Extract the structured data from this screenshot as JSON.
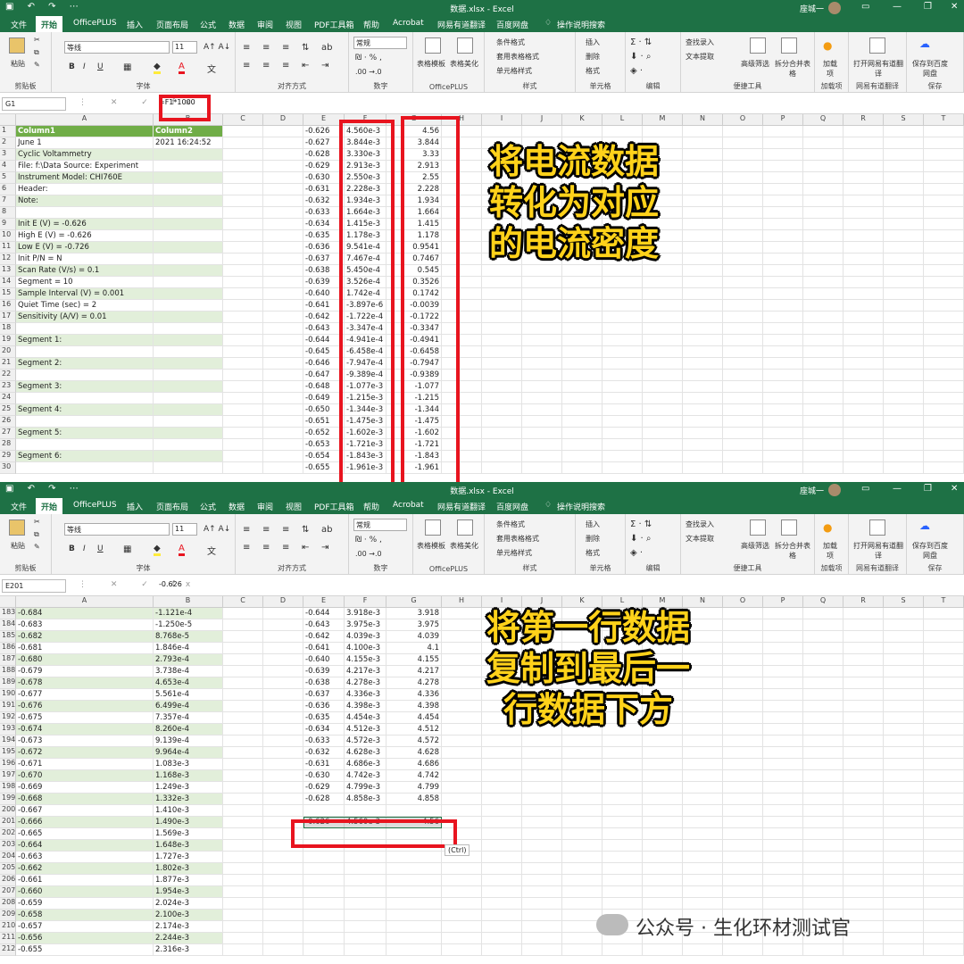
{
  "excel": {
    "title": "数据.xlsx  -  Excel",
    "user": "座城一",
    "tabs": [
      "文件",
      "开始",
      "OfficePLUS",
      "插入",
      "页面布局",
      "公式",
      "数据",
      "审阅",
      "视图",
      "PDF工具箱",
      "帮助",
      "Acrobat",
      "网易有道翻译",
      "百度网盘"
    ],
    "search": "操作说明搜索",
    "ribbon": {
      "paste": "粘贴",
      "font_name": "等线",
      "font_size": "11",
      "number_format": "常规",
      "groups": [
        "剪贴板",
        "字体",
        "对齐方式",
        "数字",
        "OfficePLUS",
        "样式",
        "单元格",
        "编辑",
        "便捷工具",
        "加载项",
        "网易有道翻译",
        "保存"
      ],
      "table_template": "表格模板",
      "table_beautify": "表格美化",
      "cond_format": "条件格式",
      "table_style": "套用表格格式",
      "cell_style": "单元格样式",
      "insert": "插入",
      "delete": "删除",
      "format": "格式",
      "find_input": "查找录入",
      "text_extract": "文本提取",
      "adv_filter": "高级筛选",
      "split_merge": "拆分合并表格",
      "addin": "加载项",
      "open_youdao": "打开网易有道翻译",
      "save_baidu": "保存到百度网盘"
    },
    "colors": {
      "excel_green": "#1e7145",
      "band": "#e2efda",
      "header": "#70ad47",
      "highlight": "#e8141f",
      "caption": "#ffd21a"
    }
  },
  "panel1": {
    "namebox": "G1",
    "formula": "=F1*1000",
    "columns": [
      "A",
      "B",
      "C",
      "D",
      "E",
      "F",
      "G",
      "H",
      "I",
      "J",
      "K",
      "L",
      "M",
      "N",
      "O",
      "P",
      "Q",
      "R",
      "S",
      "T"
    ],
    "header_a": "Column1",
    "header_b": "Column2",
    "rows": [
      {
        "n": "1",
        "a": "Column1",
        "b": "Column2",
        "e": "-0.626",
        "f": "4.560e-3",
        "g": "4.56"
      },
      {
        "n": "2",
        "a": "June 1",
        "b": "2021   16:24:52",
        "e": "-0.627",
        "f": "3.844e-3",
        "g": "3.844"
      },
      {
        "n": "3",
        "a": "Cyclic Voltammetry",
        "b": "",
        "e": "-0.628",
        "f": "3.330e-3",
        "g": "3.33"
      },
      {
        "n": "4",
        "a": "File: f:\\Data Source:  Experiment",
        "b": "",
        "e": "-0.629",
        "f": "2.913e-3",
        "g": "2.913"
      },
      {
        "n": "5",
        "a": "Instrument Model:  CHI760E",
        "b": "",
        "e": "-0.630",
        "f": "2.550e-3",
        "g": "2.55"
      },
      {
        "n": "6",
        "a": "Header:",
        "b": "",
        "e": "-0.631",
        "f": "2.228e-3",
        "g": "2.228"
      },
      {
        "n": "7",
        "a": "Note:",
        "b": "",
        "e": "-0.632",
        "f": "1.934e-3",
        "g": "1.934"
      },
      {
        "n": "8",
        "a": "",
        "b": "",
        "e": "-0.633",
        "f": "1.664e-3",
        "g": "1.664"
      },
      {
        "n": "9",
        "a": "Init E (V) = -0.626",
        "b": "",
        "e": "-0.634",
        "f": "1.415e-3",
        "g": "1.415"
      },
      {
        "n": "10",
        "a": "High E (V) = -0.626",
        "b": "",
        "e": "-0.635",
        "f": "1.178e-3",
        "g": "1.178"
      },
      {
        "n": "11",
        "a": "Low E (V) = -0.726",
        "b": "",
        "e": "-0.636",
        "f": "9.541e-4",
        "g": "0.9541"
      },
      {
        "n": "12",
        "a": "Init P/N = N",
        "b": "",
        "e": "-0.637",
        "f": "7.467e-4",
        "g": "0.7467"
      },
      {
        "n": "13",
        "a": "Scan Rate (V/s) = 0.1",
        "b": "",
        "e": "-0.638",
        "f": "5.450e-4",
        "g": "0.545"
      },
      {
        "n": "14",
        "a": "Segment = 10",
        "b": "",
        "e": "-0.639",
        "f": "3.526e-4",
        "g": "0.3526"
      },
      {
        "n": "15",
        "a": "Sample Interval (V) = 0.001",
        "b": "",
        "e": "-0.640",
        "f": "1.742e-4",
        "g": "0.1742"
      },
      {
        "n": "16",
        "a": "Quiet Time (sec) = 2",
        "b": "",
        "e": "-0.641",
        "f": "-3.897e-6",
        "g": "-0.0039"
      },
      {
        "n": "17",
        "a": "Sensitivity (A/V) = 0.01",
        "b": "",
        "e": "-0.642",
        "f": "-1.722e-4",
        "g": "-0.1722"
      },
      {
        "n": "18",
        "a": "",
        "b": "",
        "e": "-0.643",
        "f": "-3.347e-4",
        "g": "-0.3347"
      },
      {
        "n": "19",
        "a": "Segment 1:",
        "b": "",
        "e": "-0.644",
        "f": "-4.941e-4",
        "g": "-0.4941"
      },
      {
        "n": "20",
        "a": "",
        "b": "",
        "e": "-0.645",
        "f": "-6.458e-4",
        "g": "-0.6458"
      },
      {
        "n": "21",
        "a": "Segment 2:",
        "b": "",
        "e": "-0.646",
        "f": "-7.947e-4",
        "g": "-0.7947"
      },
      {
        "n": "22",
        "a": "",
        "b": "",
        "e": "-0.647",
        "f": "-9.389e-4",
        "g": "-0.9389"
      },
      {
        "n": "23",
        "a": "Segment 3:",
        "b": "",
        "e": "-0.648",
        "f": "-1.077e-3",
        "g": "-1.077"
      },
      {
        "n": "24",
        "a": "",
        "b": "",
        "e": "-0.649",
        "f": "-1.215e-3",
        "g": "-1.215"
      },
      {
        "n": "25",
        "a": "Segment 4:",
        "b": "",
        "e": "-0.650",
        "f": "-1.344e-3",
        "g": "-1.344"
      },
      {
        "n": "26",
        "a": "",
        "b": "",
        "e": "-0.651",
        "f": "-1.475e-3",
        "g": "-1.475"
      },
      {
        "n": "27",
        "a": "Segment 5:",
        "b": "",
        "e": "-0.652",
        "f": "-1.602e-3",
        "g": "-1.602"
      },
      {
        "n": "28",
        "a": "",
        "b": "",
        "e": "-0.653",
        "f": "-1.721e-3",
        "g": "-1.721"
      },
      {
        "n": "29",
        "a": "Segment 6:",
        "b": "",
        "e": "-0.654",
        "f": "-1.843e-3",
        "g": "-1.843"
      },
      {
        "n": "30",
        "a": "",
        "b": "",
        "e": "-0.655",
        "f": "-1.961e-3",
        "g": "-1.961"
      }
    ],
    "caption": [
      "将电流数据",
      "转化为对应",
      "的电流密度"
    ]
  },
  "panel2": {
    "namebox": "E201",
    "formula": "-0.626",
    "columns": [
      "A",
      "B",
      "C",
      "D",
      "E",
      "F",
      "G",
      "H",
      "I",
      "J",
      "K",
      "L",
      "M",
      "N",
      "O",
      "P",
      "Q",
      "R",
      "S",
      "T"
    ],
    "rows": [
      {
        "n": "183",
        "a": "-0.684",
        "b": "-1.121e-4",
        "e": "-0.644",
        "f": "3.918e-3",
        "g": "3.918"
      },
      {
        "n": "184",
        "a": "-0.683",
        "b": "-1.250e-5",
        "e": "-0.643",
        "f": "3.975e-3",
        "g": "3.975"
      },
      {
        "n": "185",
        "a": "-0.682",
        "b": "8.768e-5",
        "e": "-0.642",
        "f": "4.039e-3",
        "g": "4.039"
      },
      {
        "n": "186",
        "a": "-0.681",
        "b": "1.846e-4",
        "e": "-0.641",
        "f": "4.100e-3",
        "g": "4.1"
      },
      {
        "n": "187",
        "a": "-0.680",
        "b": "2.793e-4",
        "e": "-0.640",
        "f": "4.155e-3",
        "g": "4.155"
      },
      {
        "n": "188",
        "a": "-0.679",
        "b": "3.738e-4",
        "e": "-0.639",
        "f": "4.217e-3",
        "g": "4.217"
      },
      {
        "n": "189",
        "a": "-0.678",
        "b": "4.653e-4",
        "e": "-0.638",
        "f": "4.278e-3",
        "g": "4.278"
      },
      {
        "n": "190",
        "a": "-0.677",
        "b": "5.561e-4",
        "e": "-0.637",
        "f": "4.336e-3",
        "g": "4.336"
      },
      {
        "n": "191",
        "a": "-0.676",
        "b": "6.499e-4",
        "e": "-0.636",
        "f": "4.398e-3",
        "g": "4.398"
      },
      {
        "n": "192",
        "a": "-0.675",
        "b": "7.357e-4",
        "e": "-0.635",
        "f": "4.454e-3",
        "g": "4.454"
      },
      {
        "n": "193",
        "a": "-0.674",
        "b": "8.260e-4",
        "e": "-0.634",
        "f": "4.512e-3",
        "g": "4.512"
      },
      {
        "n": "194",
        "a": "-0.673",
        "b": "9.139e-4",
        "e": "-0.633",
        "f": "4.572e-3",
        "g": "4.572"
      },
      {
        "n": "195",
        "a": "-0.672",
        "b": "9.964e-4",
        "e": "-0.632",
        "f": "4.628e-3",
        "g": "4.628"
      },
      {
        "n": "196",
        "a": "-0.671",
        "b": "1.083e-3",
        "e": "-0.631",
        "f": "4.686e-3",
        "g": "4.686"
      },
      {
        "n": "197",
        "a": "-0.670",
        "b": "1.168e-3",
        "e": "-0.630",
        "f": "4.742e-3",
        "g": "4.742"
      },
      {
        "n": "198",
        "a": "-0.669",
        "b": "1.249e-3",
        "e": "-0.629",
        "f": "4.799e-3",
        "g": "4.799"
      },
      {
        "n": "199",
        "a": "-0.668",
        "b": "1.332e-3",
        "e": "-0.628",
        "f": "4.858e-3",
        "g": "4.858"
      },
      {
        "n": "200",
        "a": "-0.667",
        "b": "1.410e-3",
        "e": "",
        "f": "",
        "g": ""
      },
      {
        "n": "201",
        "a": "-0.666",
        "b": "1.490e-3",
        "e": "-0.626",
        "f": "4.560e-3",
        "g": "4.56"
      },
      {
        "n": "202",
        "a": "-0.665",
        "b": "1.569e-3",
        "e": "",
        "f": "",
        "g": ""
      },
      {
        "n": "203",
        "a": "-0.664",
        "b": "1.648e-3",
        "e": "",
        "f": "",
        "g": ""
      },
      {
        "n": "204",
        "a": "-0.663",
        "b": "1.727e-3",
        "e": "",
        "f": "",
        "g": ""
      },
      {
        "n": "205",
        "a": "-0.662",
        "b": "1.802e-3",
        "e": "",
        "f": "",
        "g": ""
      },
      {
        "n": "206",
        "a": "-0.661",
        "b": "1.877e-3",
        "e": "",
        "f": "",
        "g": ""
      },
      {
        "n": "207",
        "a": "-0.660",
        "b": "1.954e-3",
        "e": "",
        "f": "",
        "g": ""
      },
      {
        "n": "208",
        "a": "-0.659",
        "b": "2.024e-3",
        "e": "",
        "f": "",
        "g": ""
      },
      {
        "n": "209",
        "a": "-0.658",
        "b": "2.100e-3",
        "e": "",
        "f": "",
        "g": ""
      },
      {
        "n": "210",
        "a": "-0.657",
        "b": "2.174e-3",
        "e": "",
        "f": "",
        "g": ""
      },
      {
        "n": "211",
        "a": "-0.656",
        "b": "2.244e-3",
        "e": "",
        "f": "",
        "g": ""
      },
      {
        "n": "212",
        "a": "-0.655",
        "b": "2.316e-3",
        "e": "",
        "f": "",
        "g": ""
      }
    ],
    "ctrl": "(Ctrl)",
    "caption": [
      "将第一行数据",
      "复制到最后一",
      "行数据下方"
    ]
  },
  "watermark": "公众号 · 生化环材测试官"
}
